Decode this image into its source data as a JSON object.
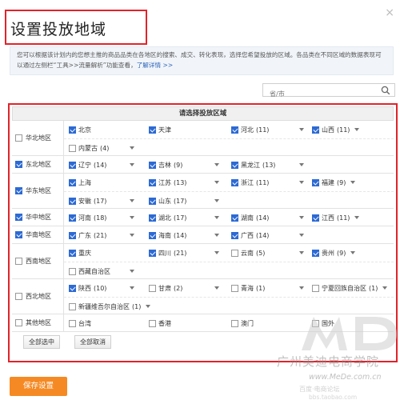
{
  "dialog": {
    "title": "设置投放地域",
    "close_glyph": "×",
    "info_text": "您可以根据该计划内的您想主推的商品品类在各地区的搜索、成交、转化表现，选择您希望投放的区域。各品类在不同区域的数据表现可以通过左侧栏“工具>>流量解析”功能查看，",
    "info_link": "了解详情 >>",
    "search_placeholder": "省/市",
    "search_icon": "search-icon"
  },
  "panel": {
    "header": "请选择投放区域",
    "regions": [
      {
        "name": "华北地区",
        "checked": false,
        "rows": [
          [
            {
              "label": "北京",
              "count": "",
              "checked": true,
              "dropdown": false
            },
            {
              "label": "天津",
              "count": "",
              "checked": true,
              "dropdown": false
            },
            {
              "label": "河北",
              "count": "(11)",
              "checked": true,
              "dropdown": true
            },
            {
              "label": "山西",
              "count": "(11)",
              "checked": true,
              "dropdown": true
            }
          ],
          [
            {
              "label": "内蒙古",
              "count": "(4)",
              "checked": false,
              "dropdown": true
            }
          ]
        ]
      },
      {
        "name": "东北地区",
        "checked": true,
        "rows": [
          [
            {
              "label": "辽宁",
              "count": "(14)",
              "checked": true,
              "dropdown": true
            },
            {
              "label": "吉林",
              "count": "(9)",
              "checked": true,
              "dropdown": true
            },
            {
              "label": "黑龙江",
              "count": "(13)",
              "checked": true,
              "dropdown": true
            }
          ]
        ]
      },
      {
        "name": "华东地区",
        "checked": true,
        "rows": [
          [
            {
              "label": "上海",
              "count": "",
              "checked": true,
              "dropdown": false
            },
            {
              "label": "江苏",
              "count": "(13)",
              "checked": true,
              "dropdown": true
            },
            {
              "label": "浙江",
              "count": "(11)",
              "checked": true,
              "dropdown": true
            },
            {
              "label": "福建",
              "count": "(9)",
              "checked": true,
              "dropdown": true
            }
          ],
          [
            {
              "label": "安徽",
              "count": "(17)",
              "checked": true,
              "dropdown": true
            },
            {
              "label": "山东",
              "count": "(17)",
              "checked": true,
              "dropdown": true
            }
          ]
        ]
      },
      {
        "name": "华中地区",
        "checked": true,
        "rows": [
          [
            {
              "label": "河南",
              "count": "(18)",
              "checked": true,
              "dropdown": true
            },
            {
              "label": "湖北",
              "count": "(17)",
              "checked": true,
              "dropdown": true
            },
            {
              "label": "湖南",
              "count": "(14)",
              "checked": true,
              "dropdown": true
            },
            {
              "label": "江西",
              "count": "(11)",
              "checked": true,
              "dropdown": true
            }
          ]
        ]
      },
      {
        "name": "华南地区",
        "checked": true,
        "rows": [
          [
            {
              "label": "广东",
              "count": "(21)",
              "checked": true,
              "dropdown": true
            },
            {
              "label": "海南",
              "count": "(14)",
              "checked": true,
              "dropdown": true
            },
            {
              "label": "广西",
              "count": "(14)",
              "checked": true,
              "dropdown": true
            }
          ]
        ]
      },
      {
        "name": "西南地区",
        "checked": false,
        "rows": [
          [
            {
              "label": "重庆",
              "count": "",
              "checked": true,
              "dropdown": false
            },
            {
              "label": "四川",
              "count": "(21)",
              "checked": true,
              "dropdown": true
            },
            {
              "label": "云南",
              "count": "(5)",
              "checked": false,
              "dropdown": true
            },
            {
              "label": "贵州",
              "count": "(9)",
              "checked": true,
              "dropdown": true
            }
          ],
          [
            {
              "label": "西藏自治区",
              "count": "",
              "checked": false,
              "dropdown": true
            }
          ]
        ]
      },
      {
        "name": "西北地区",
        "checked": false,
        "rows": [
          [
            {
              "label": "陕西",
              "count": "(10)",
              "checked": true,
              "dropdown": true
            },
            {
              "label": "甘肃",
              "count": "(2)",
              "checked": false,
              "dropdown": true
            },
            {
              "label": "青海",
              "count": "(1)",
              "checked": false,
              "dropdown": true
            },
            {
              "label": "宁夏回族自治区",
              "count": "(1)",
              "checked": false,
              "dropdown": true
            }
          ],
          [
            {
              "label": "新疆维吾尔自治区",
              "count": "(1)",
              "checked": false,
              "dropdown": true
            }
          ]
        ]
      },
      {
        "name": "其他地区",
        "checked": false,
        "rows": [
          [
            {
              "label": "台湾",
              "count": "",
              "checked": false,
              "dropdown": false
            },
            {
              "label": "香港",
              "count": "",
              "checked": false,
              "dropdown": false
            },
            {
              "label": "澳门",
              "count": "",
              "checked": false,
              "dropdown": false
            },
            {
              "label": "国外",
              "count": "",
              "checked": false,
              "dropdown": false
            }
          ]
        ]
      }
    ],
    "select_all": "全部选中",
    "deselect_all": "全部取消"
  },
  "footer": {
    "save_label": "保存设置"
  },
  "watermark": {
    "line1": "广州美迪电商学院",
    "line2": "www.MeDe.com.cn",
    "line3": "百度·电商论坛",
    "line4": "bbs.taobao.com"
  },
  "colors": {
    "highlight": "#e2232a",
    "check": "#2d6ad4",
    "save": "#f58a24",
    "link": "#2b63b8"
  }
}
